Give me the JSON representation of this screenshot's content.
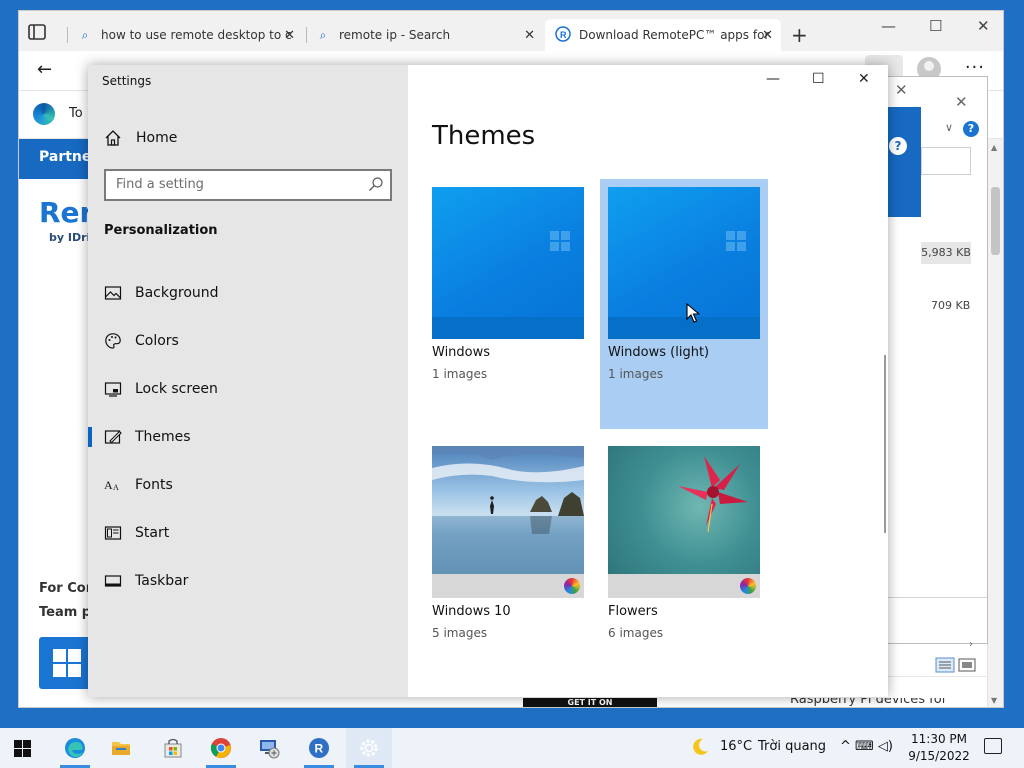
{
  "browser": {
    "tabs": [
      {
        "label": "how to use remote desktop to c",
        "icon": "search-icon"
      },
      {
        "label": "remote ip - Search",
        "icon": "search-icon"
      },
      {
        "label": "Download RemotePC™ apps for",
        "icon": "remotepc-icon"
      }
    ],
    "new_tab": "+",
    "window_controls": {
      "minimize": "—",
      "maximize": "☐",
      "close": "✕"
    },
    "more": "···",
    "edge_to": "To",
    "partner": "Partner",
    "brand": "Rer",
    "brand_sub": "by IDriv",
    "for_con": "For Con",
    "team": "Team p",
    "get_it_on": "GET IT ON",
    "rpi_text": "Raspberry Pi devices for"
  },
  "downloads": {
    "size_1": "5,983 KB",
    "size_2": "709 KB",
    "help": "?"
  },
  "settings": {
    "title": "Settings",
    "home": "Home",
    "search_placeholder": "Find a setting",
    "section": "Personalization",
    "nav": [
      {
        "label": "Background",
        "icon": "background-icon"
      },
      {
        "label": "Colors",
        "icon": "palette-icon"
      },
      {
        "label": "Lock screen",
        "icon": "lock-screen-icon"
      },
      {
        "label": "Themes",
        "icon": "themes-icon",
        "selected": true
      },
      {
        "label": "Fonts",
        "icon": "fonts-icon"
      },
      {
        "label": "Start",
        "icon": "start-icon"
      },
      {
        "label": "Taskbar",
        "icon": "taskbar-icon"
      }
    ],
    "controls": {
      "minimize": "—",
      "maximize": "☐",
      "close": "✕"
    },
    "page_title": "Themes",
    "themes": [
      {
        "name": "Windows",
        "count": "1 images"
      },
      {
        "name": "Windows (light)",
        "count": "1 images",
        "selected": true
      },
      {
        "name": "Windows 10",
        "count": "5 images"
      },
      {
        "name": "Flowers",
        "count": "6 images"
      }
    ]
  },
  "taskbar": {
    "temperature": "16°C",
    "weather": "Trời quang",
    "tray": "^  ⌨ ◁)",
    "time": "11:30 PM",
    "date": "9/15/2022"
  },
  "colors": {
    "accent": "#0a64c2",
    "selected_tile": "#a9cdf3",
    "desktop": "#1f6fc5"
  }
}
